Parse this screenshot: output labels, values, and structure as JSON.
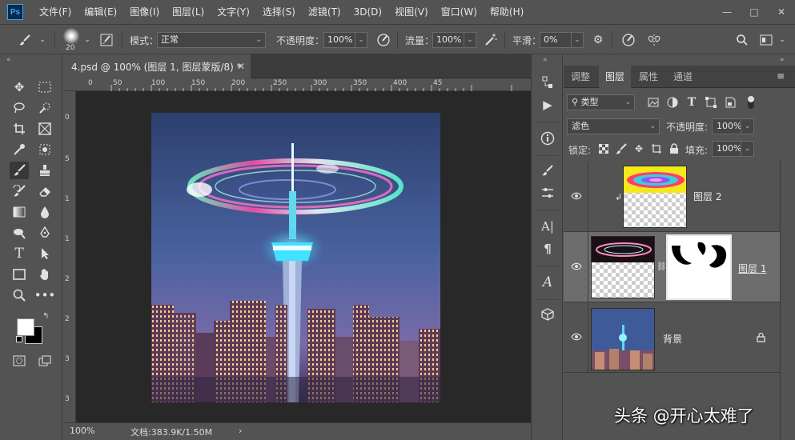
{
  "app": {
    "logo": "Ps",
    "menu": [
      "文件(F)",
      "编辑(E)",
      "图像(I)",
      "图层(L)",
      "文字(Y)",
      "选择(S)",
      "滤镜(T)",
      "3D(D)",
      "视图(V)",
      "窗口(W)",
      "帮助(H)"
    ],
    "window_controls": {
      "minimize": "—",
      "maximize": "□",
      "close": "✕"
    }
  },
  "options": {
    "brush_size": "20",
    "mode_label": "模式：",
    "mode_value": "正常",
    "opacity_label": "不透明度：",
    "opacity_value": "100%",
    "flow_label": "流量：",
    "flow_value": "100%",
    "smoothing_label": "平滑：",
    "smoothing_value": "0%"
  },
  "document": {
    "tab_title": "4.psd @ 100% (图层 1, 图层蒙版/8) *",
    "tab_close": "✕",
    "zoom": "100%",
    "doc_info": "文档:383.9K/1.50M",
    "status_arrow": "›",
    "ruler_top_labels": [
      "0",
      "50",
      "100",
      "150",
      "200",
      "250",
      "300",
      "350",
      "400",
      "45"
    ],
    "ruler_left_labels": [
      "0",
      "5",
      "1",
      "1",
      "2",
      "2",
      "3",
      "3"
    ]
  },
  "panels": {
    "tabs": [
      "调整",
      "图层",
      "属性",
      "通道"
    ],
    "active_tab": "图层",
    "filter_kind": "类型",
    "blend_mode": "滤色",
    "opacity_label": "不透明度:",
    "opacity_value": "100%",
    "lock_label": "锁定:",
    "fill_label": "填充:",
    "fill_value": "100%",
    "layers": [
      {
        "name": "图层 2",
        "clipped": true,
        "selected": false
      },
      {
        "name": "图层 1",
        "clipped": false,
        "selected": true,
        "has_mask": true
      },
      {
        "name": "背景",
        "locked": true,
        "selected": false
      }
    ]
  },
  "watermark": "头条 @开心太难了",
  "colors": {
    "ui_bg": "#535353",
    "canvas_bg": "#282828",
    "selected_layer": "#6d6d6d",
    "ps_blue": "#31a8ff"
  }
}
